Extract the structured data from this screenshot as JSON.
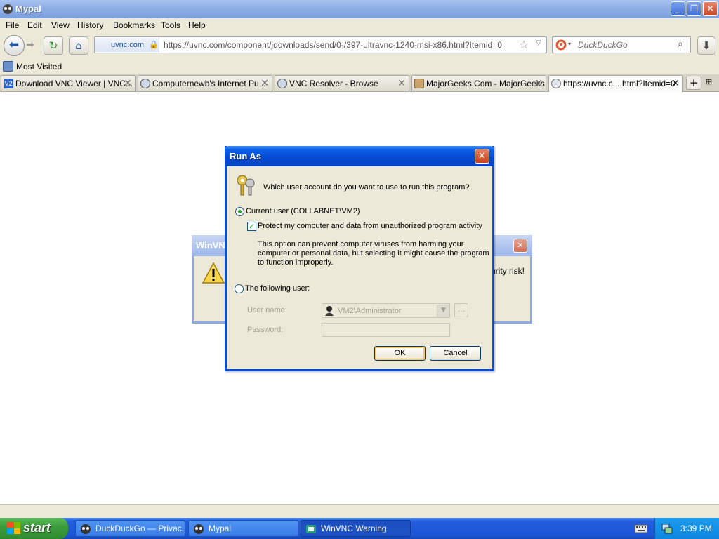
{
  "window": {
    "title": "Mypal",
    "controls": [
      "minimize",
      "maximize",
      "close"
    ]
  },
  "menu": [
    "File",
    "Edit",
    "View",
    "History",
    "Bookmarks",
    "Tools",
    "Help"
  ],
  "nav": {
    "site_identity": "uvnc.com",
    "url": "https://uvnc.com/component/jdownloads/send/0-/397-ultravnc-1240-msi-x86.html?Itemid=0",
    "search_engine": "DuckDuckGo",
    "search_placeholder": "DuckDuckGo"
  },
  "bookmarks": {
    "most_visited": "Most Visited"
  },
  "tabs": [
    {
      "label": "Download VNC Viewer | VNC...",
      "icon": "vnc-icon",
      "color": "#2e64c8"
    },
    {
      "label": "Computernewb's Internet Pu...",
      "icon": "globe-icon",
      "color": "#505050"
    },
    {
      "label": "VNC Resolver - Browse",
      "icon": "globe-icon",
      "color": "#505050"
    },
    {
      "label": "MajorGeeks.Com - MajorGeeks",
      "icon": "majorgeeks-icon",
      "color": "#8a6a3a"
    },
    {
      "label": "https://uvnc.c....html?Itemid=0",
      "icon": "globe-icon",
      "color": "#707070"
    }
  ],
  "warning_dialog": {
    "title": "WinVNC",
    "text_fragment": "urity risk!"
  },
  "runas": {
    "title": "Run As",
    "question": "Which user account do you want to use to run this program?",
    "current_user_label": "Current user (COLLABNET\\VM2)",
    "protect_label": "Protect my computer and data from unauthorized program activity",
    "protect_desc": [
      "This option can prevent computer viruses from harming your",
      "computer or personal data, but selecting it might cause the program",
      "to function improperly."
    ],
    "following_user_label": "The following user:",
    "user_name_label": "User name:",
    "user_name_value": "VM2\\Administrator",
    "password_label": "Password:",
    "browse_label": "...",
    "ok_label": "OK",
    "cancel_label": "Cancel"
  },
  "taskbar": {
    "start_label": "start",
    "tasks": [
      {
        "label": "DuckDuckGo — Privac..."
      },
      {
        "label": "Mypal"
      },
      {
        "label": "WinVNC Warning"
      }
    ],
    "clock": "3:39 PM"
  },
  "colors": {
    "xp_blue": "#0a4dd1",
    "taskbar": "#245edb",
    "start_green": "#3c9d3c",
    "dialog_face": "#ece9d8"
  }
}
